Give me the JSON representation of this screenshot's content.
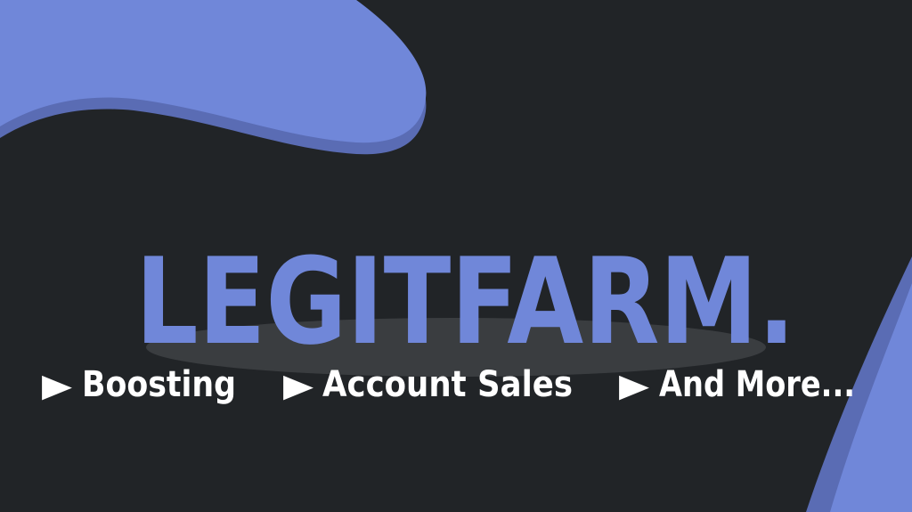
{
  "brand": {
    "title": "LEGITFARM."
  },
  "taglines": [
    {
      "icon": "play-triangle-icon",
      "label": "Boosting"
    },
    {
      "icon": "play-triangle-icon",
      "label": "Account Sales"
    },
    {
      "icon": "play-triangle-icon",
      "label": "And More..."
    }
  ],
  "colors": {
    "background": "#212427",
    "accent": "#7087d9",
    "accent_shadow": "#5a6cb4",
    "text": "#ffffff",
    "spot_shadow": "#3a3d40"
  }
}
